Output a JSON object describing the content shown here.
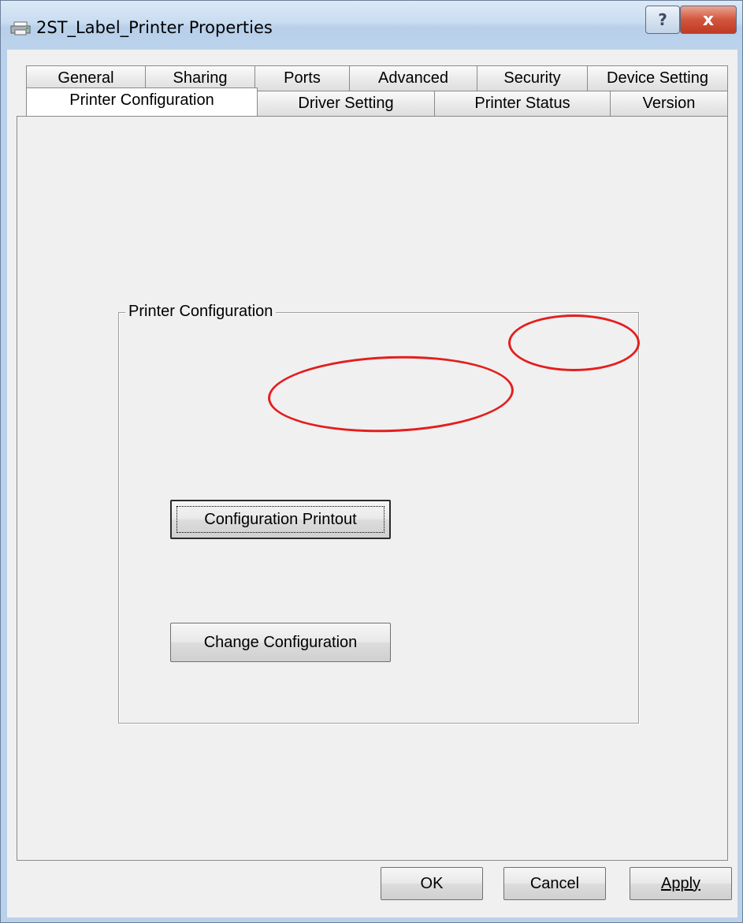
{
  "window": {
    "title": "2ST_Label_Printer Properties",
    "help_label": "?",
    "close_label": "x"
  },
  "tabs": {
    "back_row": [
      "General",
      "Sharing",
      "Ports",
      "Advanced",
      "Security",
      "Device Setting"
    ],
    "front_row": [
      "Printer Configuration",
      "Driver Setting",
      "Printer Status",
      "Version"
    ],
    "active": "Printer Configuration"
  },
  "group": {
    "label": "Printer Configuration",
    "configuration_printout_label": "Configuration Printout",
    "change_configuration_label": "Change Configuration"
  },
  "footer": {
    "ok_label": "OK",
    "cancel_label": "Cancel",
    "apply_label": "Apply"
  },
  "annotation_color": "#e41e1e"
}
